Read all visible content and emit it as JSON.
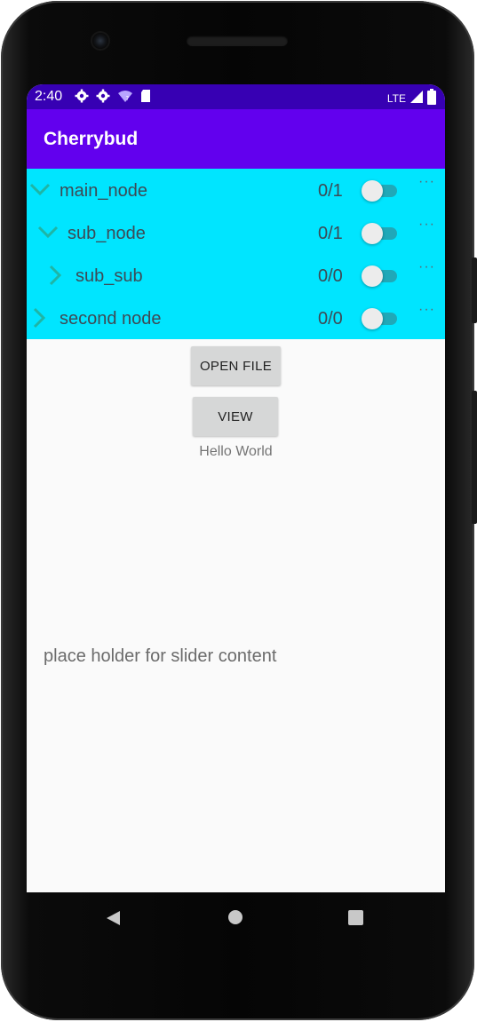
{
  "status_bar": {
    "time": "2:40",
    "network": "LTE"
  },
  "app_bar": {
    "title": "Cherrybud"
  },
  "tree": {
    "background": "#00e5ff",
    "nodes": [
      {
        "label": "main_node",
        "count": "0/1",
        "expanded": true,
        "more": "···"
      },
      {
        "label": "sub_node",
        "count": "0/1",
        "expanded": true,
        "more": "···"
      },
      {
        "label": "sub_sub",
        "count": "0/0",
        "expanded": false,
        "more": "···"
      },
      {
        "label": "second node",
        "count": "0/0",
        "expanded": false,
        "more": "···"
      }
    ]
  },
  "main": {
    "open_file_label": "OPEN FILE",
    "view_label": "VIEW",
    "hello_text": "Hello World",
    "placeholder_text": "place holder for slider content"
  },
  "colors": {
    "status_bar": "#3700b3",
    "app_bar": "#6200ee",
    "chevron": "#1fb5a5",
    "switch_track": "#20a8b8"
  }
}
